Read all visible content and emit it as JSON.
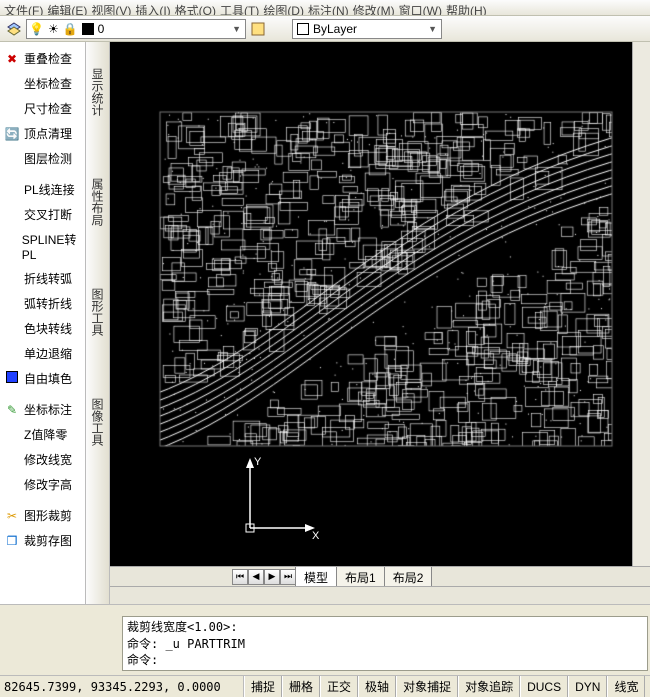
{
  "menu": {
    "items": [
      "文件(F)",
      "编辑(E)",
      "视图(V)",
      "插入(I)",
      "格式(O)",
      "工具(T)",
      "绘图(D)",
      "标注(N)",
      "修改(M)",
      "窗口(W)",
      "帮助(H)"
    ]
  },
  "toolbar": {
    "layer": {
      "name": "0",
      "combo_label": "0"
    },
    "bylayer": "ByLayer"
  },
  "sidebar": {
    "items": [
      {
        "icon": "✖",
        "label": "重叠检查",
        "color": "#c00"
      },
      {
        "icon": "",
        "label": "坐标检查"
      },
      {
        "icon": "",
        "label": "尺寸检查"
      },
      {
        "icon": "🔄",
        "label": "顶点清理",
        "color": "#06c"
      },
      {
        "icon": "",
        "label": "图层检测"
      },
      {
        "sep": true
      },
      {
        "icon": "",
        "label": "PL线连接"
      },
      {
        "icon": "",
        "label": "交叉打断"
      },
      {
        "icon": "",
        "label": "SPLINE转PL"
      },
      {
        "icon": "",
        "label": "折线转弧"
      },
      {
        "icon": "",
        "label": "弧转折线"
      },
      {
        "icon": "",
        "label": "色块转线"
      },
      {
        "icon": "",
        "label": "单边退缩"
      },
      {
        "icon": "blue-sw",
        "label": "自由填色"
      },
      {
        "sep": true
      },
      {
        "icon": "✎",
        "label": "坐标标注",
        "color": "#393"
      },
      {
        "icon": "",
        "label": "Z值降零"
      },
      {
        "icon": "",
        "label": "修改线宽"
      },
      {
        "icon": "",
        "label": "修改字高"
      },
      {
        "sep": true
      },
      {
        "icon": "✂",
        "label": "图形裁剪",
        "color": "#d90"
      },
      {
        "icon": "❒",
        "label": "裁剪存图",
        "color": "#06c"
      }
    ]
  },
  "palettes": [
    "显示统计",
    "属性布局",
    "图形工具",
    "图像工具"
  ],
  "axis": {
    "x": "X",
    "y": "Y"
  },
  "tabs": {
    "items": [
      "模型",
      "布局1",
      "布局2"
    ],
    "active": 0
  },
  "command": {
    "lines": [
      "裁剪线宽度<1.00>:",
      "命令: _u PARTTRIM",
      "命令:"
    ]
  },
  "status": {
    "coords": "82645.7399, 93345.2293, 0.0000",
    "toggles": [
      "捕捉",
      "栅格",
      "正交",
      "极轴",
      "对象捕捉",
      "对象追踪",
      "DUCS",
      "DYN",
      "线宽"
    ]
  }
}
